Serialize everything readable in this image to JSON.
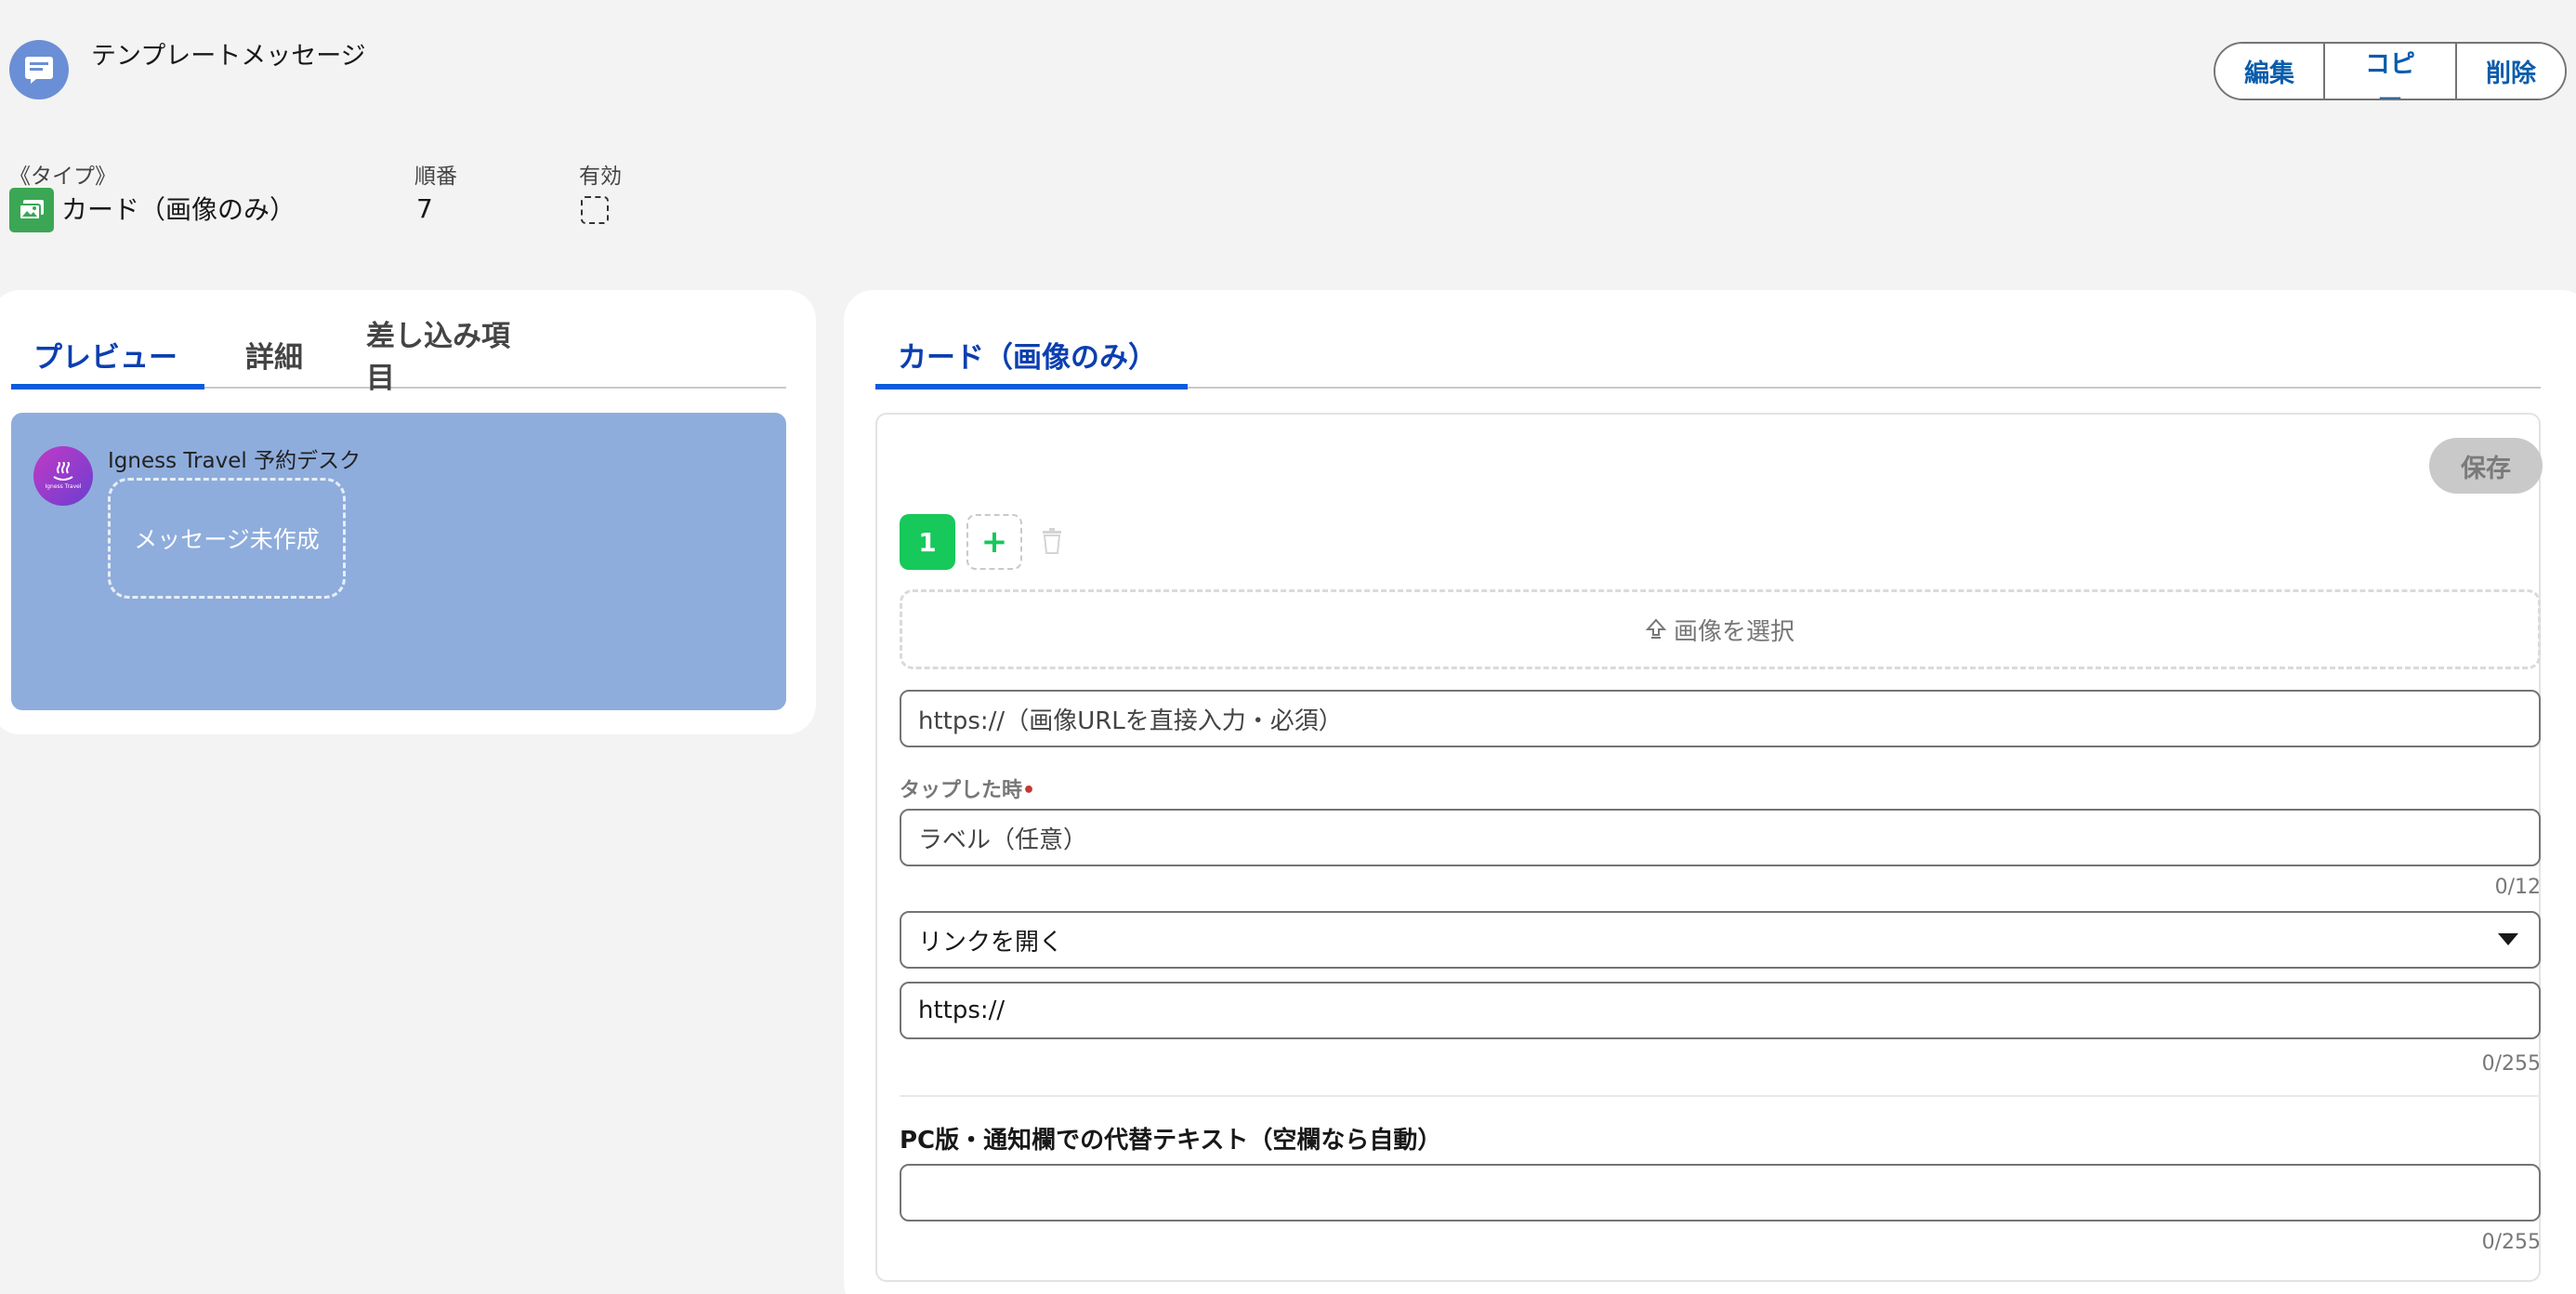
{
  "header": {
    "title": "テンプレートメッセージ",
    "icon": "template-message-icon",
    "actions": {
      "edit": "編集",
      "copy": "コピー",
      "delete": "削除"
    }
  },
  "fields": {
    "type_label": "《タイプ》",
    "type_value": "カード（画像のみ）",
    "order_label": "順番",
    "order_value": "7",
    "active_label": "有効"
  },
  "left_panel": {
    "tabs": [
      "プレビュー",
      "詳細",
      "差し込み項目"
    ],
    "active_tab": "プレビュー",
    "preview": {
      "sender": "Igness Travel 予約デスク",
      "avatar_text": "Igness Travel",
      "empty_message": "メッセージ未作成"
    }
  },
  "right_panel": {
    "tab": "カード（画像のみ）",
    "save_label": "保存",
    "page_number": "1",
    "upload_label": "画像を選択",
    "image_url_placeholder": "https://（画像URLを直接入力・必須）",
    "tap_label": "タップした時",
    "label_placeholder": "ラベル（任意）",
    "label_counter": "0/12",
    "action_select": "リンクを開く",
    "link_value": "https://",
    "link_counter": "0/255",
    "alt_text_label": "PC版・通知欄での代替テキスト（空欄なら自動）",
    "alt_text_counter": "0/255"
  },
  "colors": {
    "accent": "#0b5cab",
    "active_tab": "#0b3fb0",
    "preview_bg": "#8eaddc",
    "page_badge": "#17c85a",
    "type_icon": "#3ba755"
  }
}
